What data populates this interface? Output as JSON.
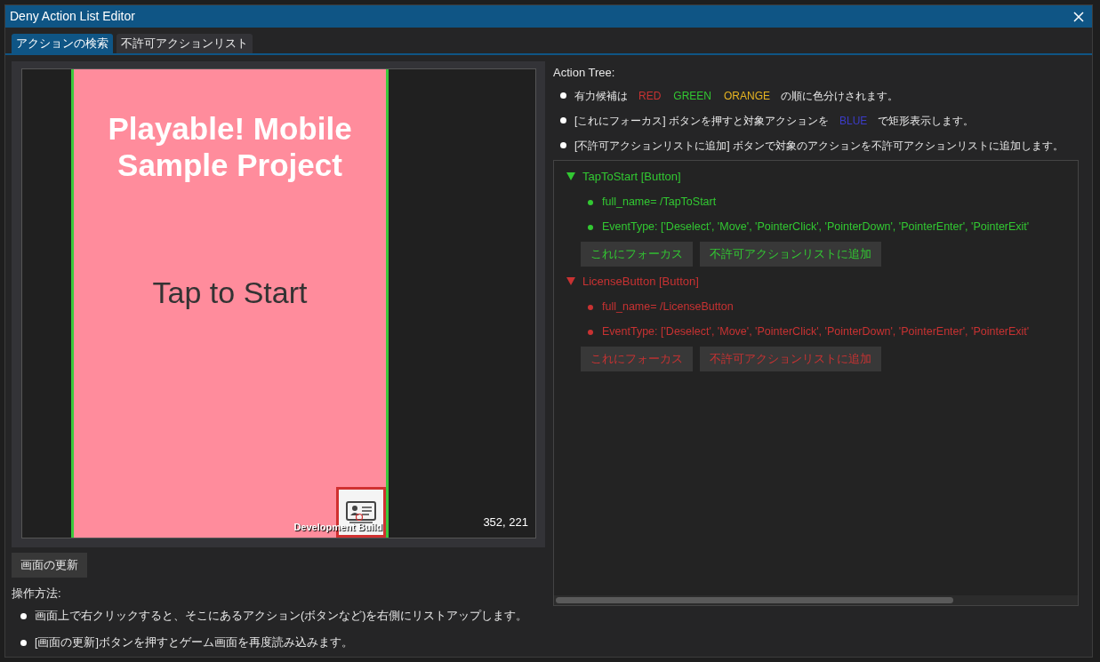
{
  "window": {
    "title": "Deny Action List Editor"
  },
  "tabs": [
    {
      "label": "アクションの検索",
      "selected": true
    },
    {
      "label": "不許可アクションリスト",
      "selected": false
    }
  ],
  "game_view": {
    "title": "Playable! Mobile Sample Project",
    "tap_text": "Tap to Start",
    "build_label": "Development Build",
    "coordinates": "352, 221"
  },
  "refresh_button": "画面の更新",
  "instructions": {
    "heading": "操作方法:",
    "items": [
      "画面上で右クリックすると、そこにあるアクション(ボタンなど)を右側にリストアップします。",
      "[画面の更新]ボタンを押すとゲーム画面を再度読み込みます。"
    ]
  },
  "action_tree": {
    "heading": "Action Tree:",
    "notes": [
      [
        {
          "text": "有力候補は"
        },
        {
          "text": "RED",
          "color": "#c83232"
        },
        {
          "text": "GREEN",
          "color": "#32c832"
        },
        {
          "text": "ORANGE",
          "color": "#e6b422"
        },
        {
          "text": "の順に色分けされます。"
        }
      ],
      [
        {
          "text": "[これにフォーカス] ボタンを押すと対象アクションを"
        },
        {
          "text": "BLUE",
          "color": "#3c3cc8"
        },
        {
          "text": "で矩形表示します。"
        }
      ],
      [
        {
          "text": "[不許可アクションリストに追加] ボタンで対象のアクションを不許可アクションリストに追加します。"
        }
      ]
    ],
    "nodes": [
      {
        "label": "TapToStart [Button]",
        "color": "#32c832",
        "expanded": true,
        "children": [
          "full_name= /TapToStart",
          "EventType: ['Deselect', 'Move', 'PointerClick', 'PointerDown', 'PointerEnter', 'PointerExit'"
        ],
        "buttons": [
          "これにフォーカス",
          "不許可アクションリストに追加"
        ]
      },
      {
        "label": "LicenseButton [Button]",
        "color": "#c83232",
        "expanded": true,
        "children": [
          "full_name= /LicenseButton",
          "EventType: ['Deselect', 'Move', 'PointerClick', 'PointerDown', 'PointerEnter', 'PointerExit'"
        ],
        "buttons": [
          "これにフォーカス",
          "不許可アクションリストに追加"
        ]
      }
    ]
  }
}
